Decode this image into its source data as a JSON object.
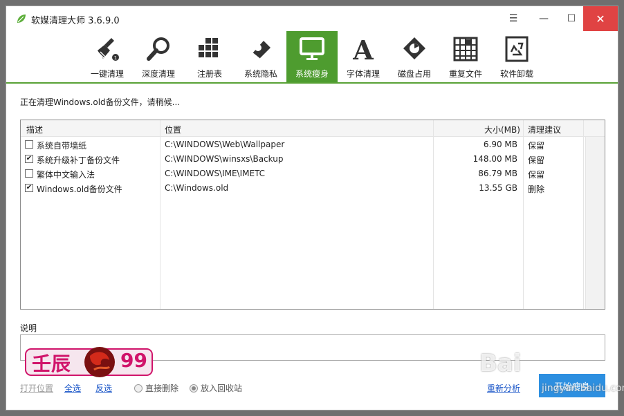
{
  "window": {
    "title": "软媒清理大师 3.6.9.0",
    "menu_icon": "☰",
    "minimize_icon": "—",
    "maximize_icon": "☐",
    "close_icon": "✕"
  },
  "toolbar": {
    "items": [
      {
        "label": "一键清理",
        "icon": "broom-icon"
      },
      {
        "label": "深度清理",
        "icon": "magnifier-icon"
      },
      {
        "label": "注册表",
        "icon": "registry-blocks-icon"
      },
      {
        "label": "系统隐私",
        "icon": "eraser-icon"
      },
      {
        "label": "系统瘦身",
        "icon": "monitor-icon",
        "active": true
      },
      {
        "label": "字体清理",
        "icon": "font-a-icon"
      },
      {
        "label": "磁盘占用",
        "icon": "disk-pie-icon"
      },
      {
        "label": "重复文件",
        "icon": "duplicate-grid-icon"
      },
      {
        "label": "软件卸载",
        "icon": "recycle-bin-icon"
      }
    ]
  },
  "status_text": "正在清理Windows.old备份文件，请稍候...",
  "table": {
    "headers": {
      "desc": "描述",
      "location": "位置",
      "size": "大小(MB)",
      "advice": "清理建议"
    },
    "rows": [
      {
        "checked": false,
        "desc": "系统自带墙纸",
        "location": "C:\\WINDOWS\\Web\\Wallpaper",
        "size": "6.90 MB",
        "advice": "保留"
      },
      {
        "checked": true,
        "desc": "系统升级补丁备份文件",
        "location": "C:\\WINDOWS\\winsxs\\Backup",
        "size": "148.00 MB",
        "advice": "保留"
      },
      {
        "checked": false,
        "desc": "繁体中文输入法",
        "location": "C:\\WINDOWS\\IME\\IMETC",
        "size": "86.79 MB",
        "advice": "保留"
      },
      {
        "checked": true,
        "desc": "Windows.old备份文件",
        "location": "C:\\Windows.old",
        "size": "13.55 GB",
        "advice": "删除"
      }
    ]
  },
  "description": {
    "label": "说明",
    "value": ""
  },
  "bottom": {
    "open_location": "打开位置",
    "select_all": "全选",
    "invert_select": "反选",
    "direct_delete": "直接删除",
    "recycle": "放入回收站",
    "reanalyze": "重新分析",
    "start_label": "开始瘦身"
  },
  "watermark": {
    "chars_left": "壬辰",
    "number": "99"
  },
  "baidu_watermark": {
    "big": "Bai",
    "small": "jingyan.baidu.com"
  },
  "colors": {
    "accent": "#58a135",
    "active_tab": "#4e9c2f",
    "close": "#e04343",
    "start": "#2d8fe0"
  }
}
